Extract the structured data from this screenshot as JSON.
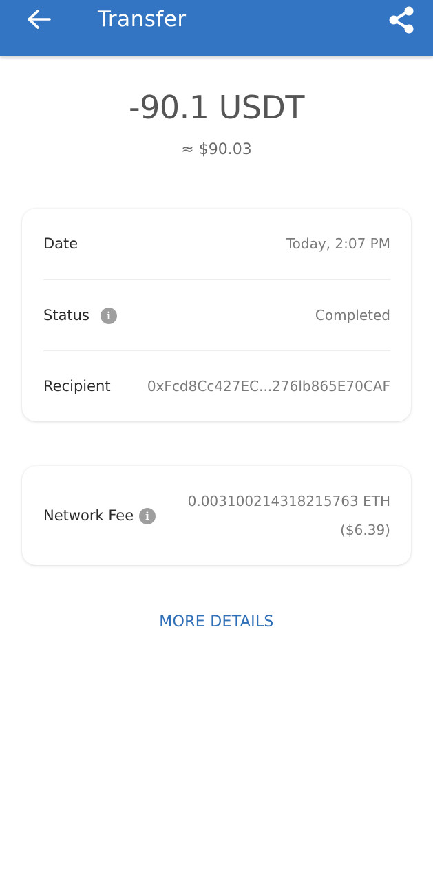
{
  "header": {
    "title": "Transfer",
    "back_icon": "arrow-left-icon",
    "share_icon": "share-icon",
    "background_color": "#3375c2"
  },
  "summary": {
    "amount": "-90.1 USDT",
    "fiat_value": "≈ $90.03"
  },
  "details": {
    "date": {
      "label": "Date",
      "value": "Today, 2:07 PM"
    },
    "status": {
      "label": "Status",
      "value": "Completed",
      "info_icon": "info-icon"
    },
    "recipient": {
      "label": "Recipient",
      "value": "0xFcd8Cc427EC...276lb865E70CAF"
    }
  },
  "network_fee": {
    "label": "Network Fee",
    "info_icon": "info-icon",
    "value_crypto": "0.003100214318215763 ETH",
    "value_fiat": "($6.39)"
  },
  "actions": {
    "more_details_label": "MORE DETAILS",
    "link_color": "#2f6fb8"
  }
}
